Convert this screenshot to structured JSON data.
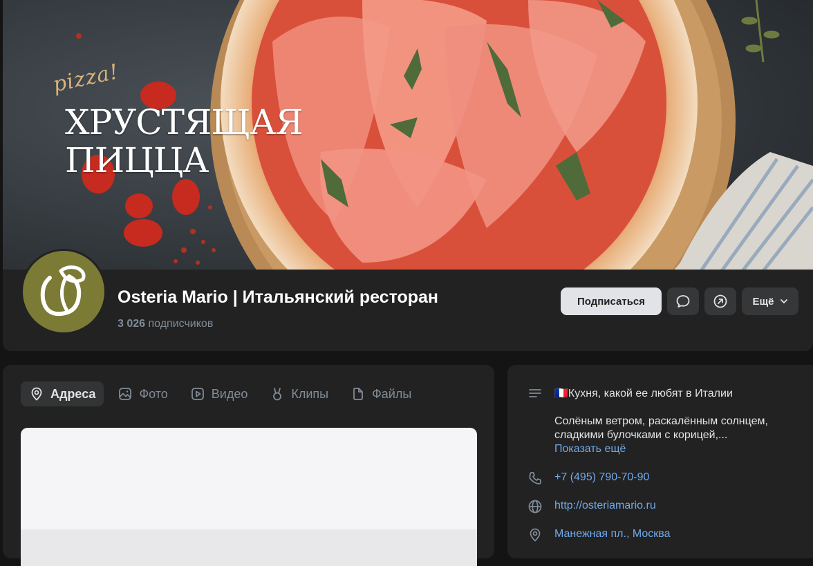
{
  "cover": {
    "script_text": "pizza!",
    "title_line1": "ХРУСТЯЩАЯ",
    "title_line2": "ПИЦЦА"
  },
  "group": {
    "name": "Osteria Mario | Итальянский ресторан",
    "subscribers_count": "3 026",
    "subscribers_label": "подписчиков"
  },
  "actions": {
    "subscribe_label": "Подписаться",
    "more_label": "Ещё"
  },
  "tabs": [
    {
      "label": "Адреса",
      "icon": "location-pin-icon",
      "active": true
    },
    {
      "label": "Фото",
      "icon": "photo-icon",
      "active": false
    },
    {
      "label": "Видео",
      "icon": "video-icon",
      "active": false
    },
    {
      "label": "Клипы",
      "icon": "clips-icon",
      "active": false
    },
    {
      "label": "Файлы",
      "icon": "file-icon",
      "active": false
    }
  ],
  "info": {
    "headline": "🇫🇷Кухня, какой ее любят в Италии",
    "description": "Солёным ветром, раскалённым солнцем, сладкими булочками с корицей,...",
    "show_more": "Показать ещё",
    "phone": "+7 (495) 790-70-90",
    "website": "http://osteriamario.ru",
    "address": "Манежная пл., Москва"
  },
  "colors": {
    "accent_link": "#71aaeb",
    "avatar_bg": "#7b7b35",
    "panel_bg": "#222222",
    "page_bg": "#141414"
  }
}
